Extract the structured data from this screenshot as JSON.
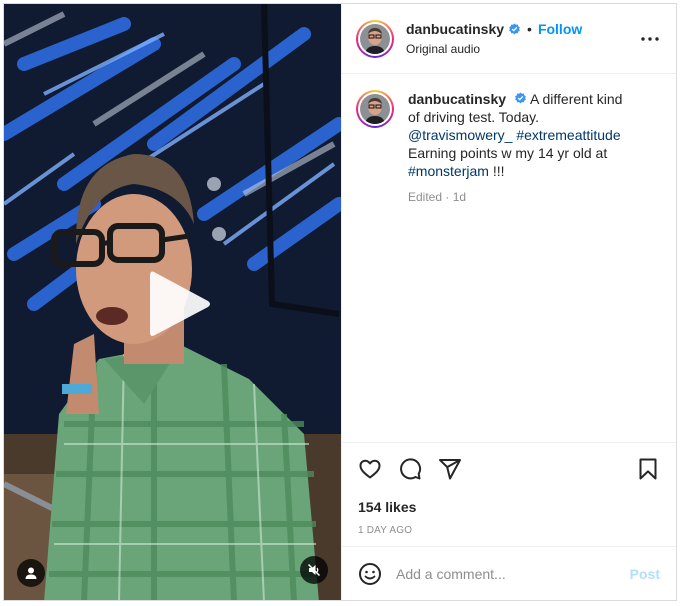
{
  "header": {
    "username": "danbucatinsky",
    "dot": "•",
    "follow_label": "Follow",
    "audio_label": "Original audio"
  },
  "caption": {
    "username": "danbucatinsky",
    "text_1": "A different kind of driving test. Today.",
    "mention": "@travismowery_",
    "hashtag_1": "#extremeattitude",
    "text_2": "Earning points w my 14 yr old at",
    "hashtag_2": "#monsterjam",
    "text_3": "!!!",
    "meta": "Edited · 1d"
  },
  "engagement": {
    "likes": "154 likes",
    "time": "1 DAY AGO"
  },
  "comment_box": {
    "placeholder": "Add a comment...",
    "post_label": "Post"
  },
  "colors": {
    "accent": "#0095f6",
    "post_disabled": "#b2dffc",
    "link": "#00376b",
    "muted": "#8e8e8e"
  },
  "icons": {
    "play": "play-icon",
    "user_tag": "user-icon",
    "mute": "speaker-muted-icon",
    "more": "more-options-icon",
    "like": "heart-icon",
    "comment": "comment-icon",
    "share": "share-icon",
    "save": "bookmark-icon",
    "emoji": "emoji-icon",
    "verified": "verified-badge-icon"
  }
}
